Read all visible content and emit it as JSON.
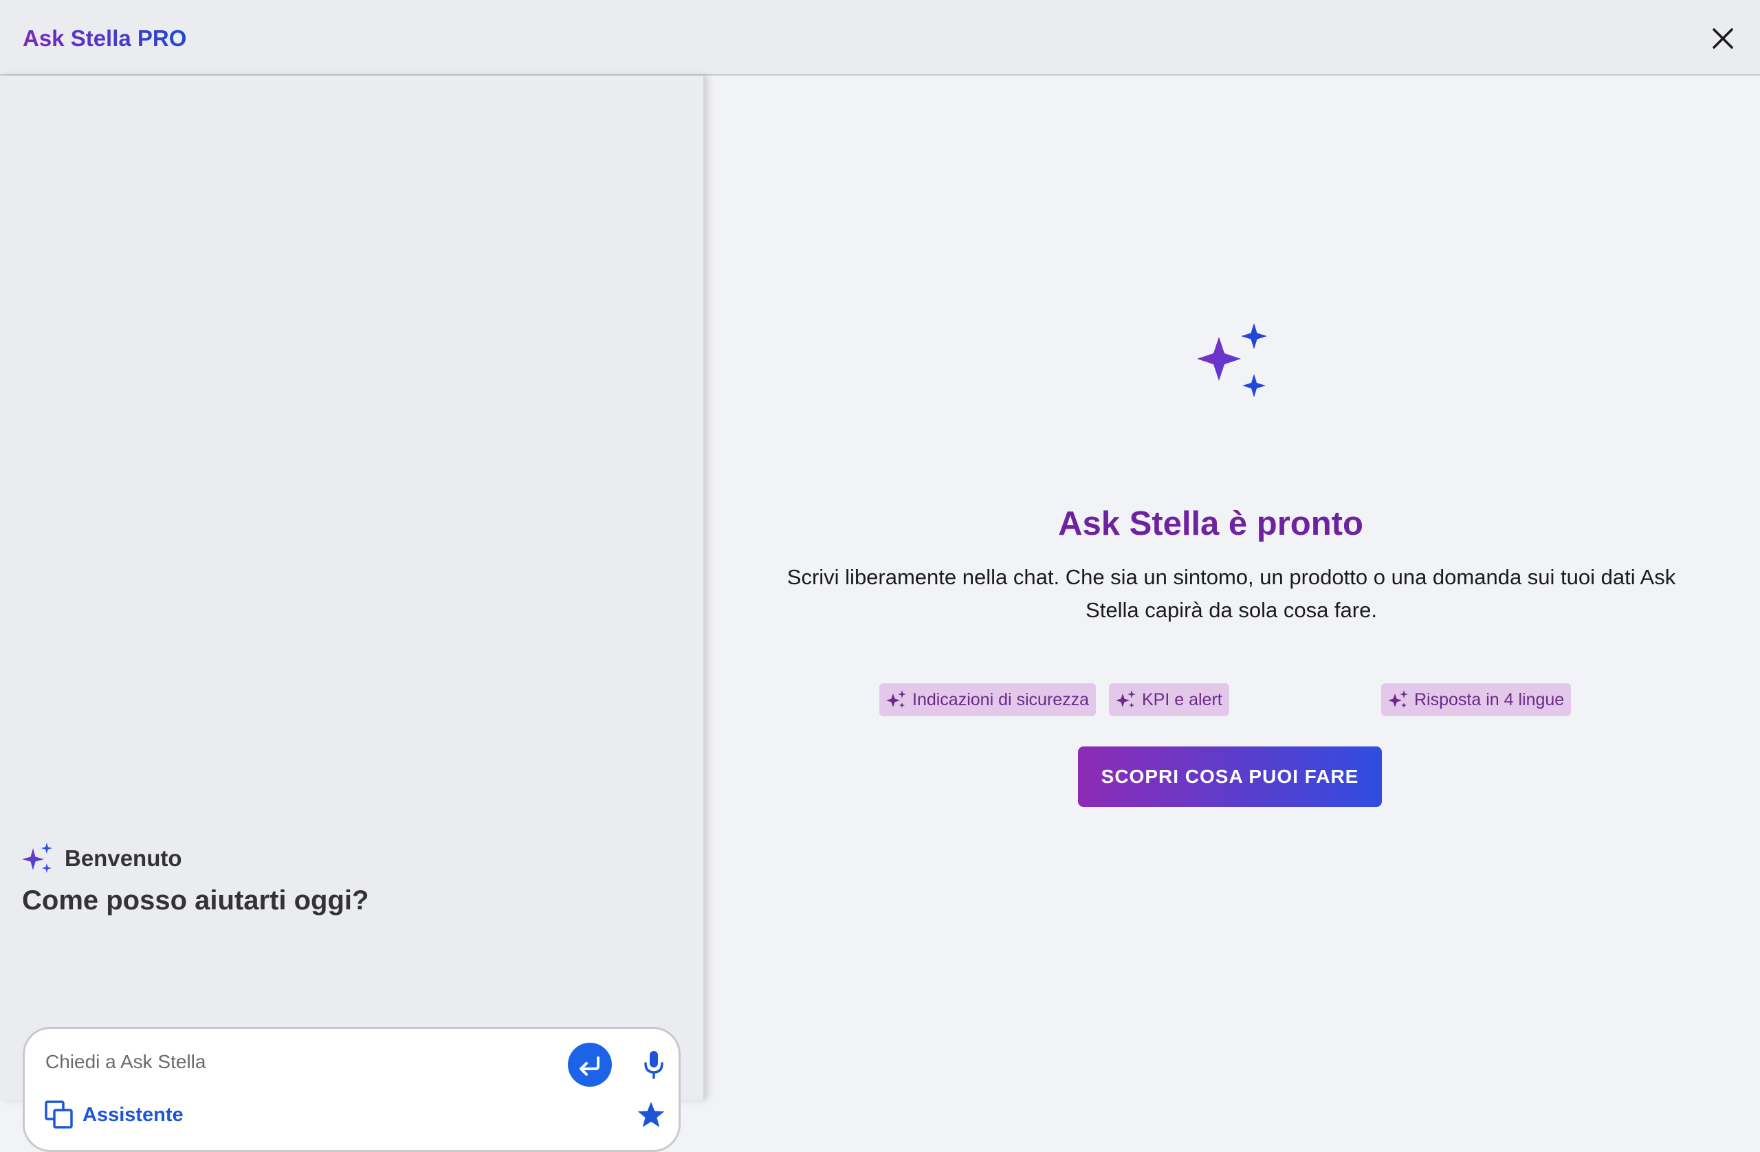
{
  "app": {
    "title": "Ask Stella PRO"
  },
  "icons": {
    "close": "close-icon",
    "sparkle": "sparkle-icon",
    "send": "enter-arrow-icon",
    "mic": "microphone-icon",
    "assistant": "copy-squares-icon",
    "favorite": "star-icon"
  },
  "colors": {
    "brand_purple": "#7a2ab8",
    "brand_blue": "#2247d6",
    "send_button": "#1d63e8",
    "chip_bg": "#e3c8ea",
    "chip_text": "#6b2a8a"
  },
  "sidebar": {
    "welcome_label": "Benvenuto",
    "question": "Come posso aiutarti oggi?",
    "chat": {
      "placeholder": "Chiedi a Ask Stella",
      "value": "",
      "assistant_label": "Assistente"
    }
  },
  "main": {
    "title": "Ask Stella è pronto",
    "description": "Scrivi liberamente nella chat. Che sia un sintomo, un prodotto o una domanda sui tuoi dati Ask Stella capirà da sola cosa fare.",
    "chips": [
      {
        "label": "Indicazioni di sicurezza"
      },
      {
        "label": "KPI e alert"
      },
      {
        "label": "Risposta in 4 lingue"
      }
    ],
    "cta_label": "SCOPRI COSA PUOI FARE"
  }
}
